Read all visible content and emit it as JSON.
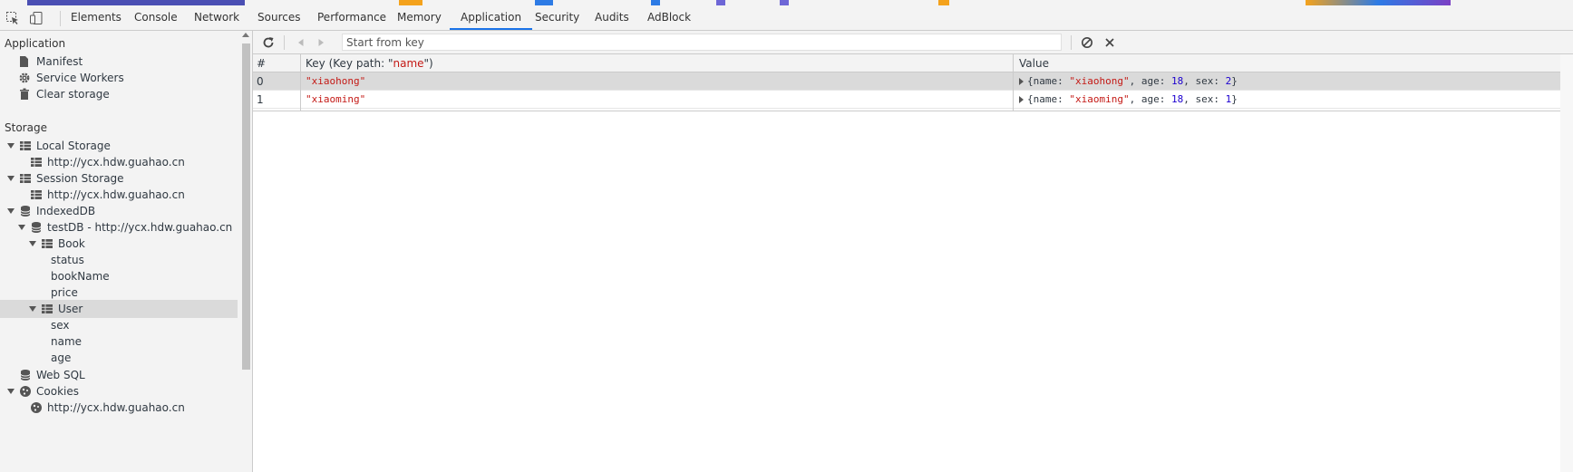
{
  "tabs": [
    {
      "label": "Elements"
    },
    {
      "label": "Console"
    },
    {
      "label": "Network"
    },
    {
      "label": "Sources"
    },
    {
      "label": "Performance"
    },
    {
      "label": "Memory"
    },
    {
      "label": "Application"
    },
    {
      "label": "Security"
    },
    {
      "label": "Audits"
    },
    {
      "label": "AdBlock"
    }
  ],
  "active_tab": "Application",
  "sidebar": {
    "application_title": "Application",
    "application_items": [
      "Manifest",
      "Service Workers",
      "Clear storage"
    ],
    "storage_title": "Storage",
    "local_storage": "Local Storage",
    "local_storage_origin": "http://ycx.hdw.guahao.cn",
    "session_storage": "Session Storage",
    "session_storage_origin": "http://ycx.hdw.guahao.cn",
    "indexeddb": "IndexedDB",
    "database": "testDB - http://ycx.hdw.guahao.cn",
    "store_book": "Book",
    "book_indexes": [
      "status",
      "bookName",
      "price"
    ],
    "store_user": "User",
    "user_indexes": [
      "sex",
      "name",
      "age"
    ],
    "web_sql": "Web SQL",
    "cookies": "Cookies",
    "cookies_origin": "http://ycx.hdw.guahao.cn"
  },
  "toolbar": {
    "search_placeholder": "Start from key"
  },
  "table": {
    "headers": {
      "index": "#",
      "key_prefix": "Key (Key path: \"",
      "key_path": "name",
      "key_suffix": "\")",
      "value": "Value"
    },
    "rows": [
      {
        "index": "0",
        "key": "\"xiaohong\"",
        "name": "\"xiaohong\"",
        "age": "18",
        "sex": "2"
      },
      {
        "index": "1",
        "key": "\"xiaoming\"",
        "name": "\"xiaoming\"",
        "age": "18",
        "sex": "1"
      }
    ],
    "value_open": "{name: ",
    "age_label": ", age: ",
    "sex_label": ", sex: ",
    "value_close": "}"
  },
  "colors": {
    "accent": "#1a73e8",
    "string": "#c41a16",
    "number": "#1c00cf",
    "selected_row": "#dadada"
  }
}
